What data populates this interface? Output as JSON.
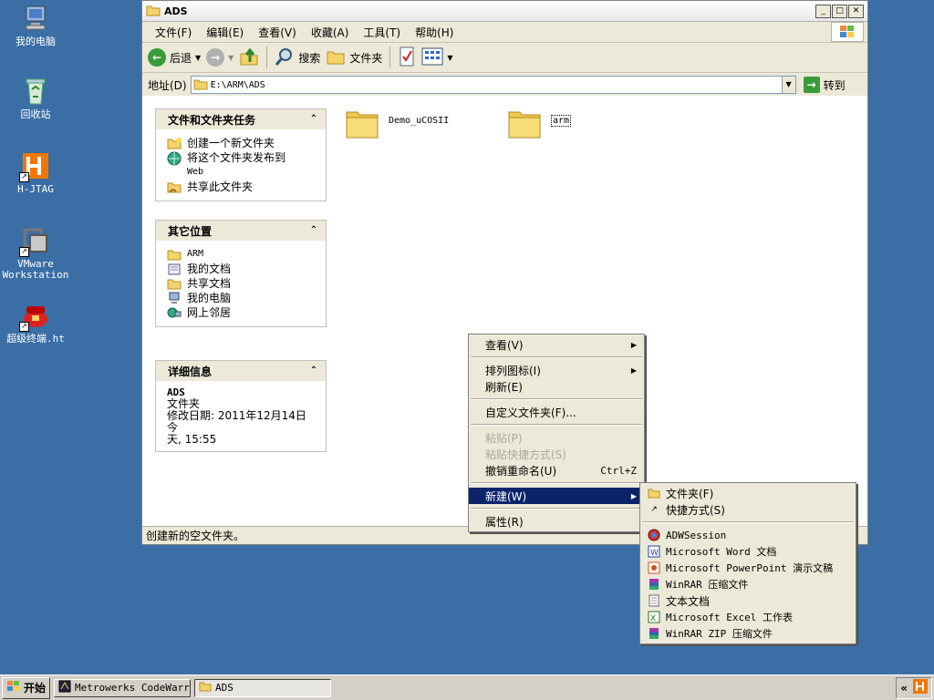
{
  "desktop": {
    "icons": [
      {
        "label": "我的电脑",
        "icon": "my-computer-icon"
      },
      {
        "label": "回收站",
        "icon": "recycle-bin-icon"
      },
      {
        "label": "H-JTAG",
        "icon": "hjtag-icon"
      },
      {
        "label": "VMware Workstation",
        "icon": "vmware-icon"
      },
      {
        "label": "超级终端.ht",
        "icon": "hyperterminal-icon"
      }
    ]
  },
  "window": {
    "title": "ADS",
    "menu": [
      "文件(F)",
      "编辑(E)",
      "查看(V)",
      "收藏(A)",
      "工具(T)",
      "帮助(H)"
    ],
    "toolbar": {
      "back": "后退",
      "search": "搜索",
      "folders": "文件夹"
    },
    "address": {
      "label": "地址(D)",
      "value": "E:\\ARM\\ADS",
      "go": "转到"
    },
    "status": "创建新的空文件夹。"
  },
  "panels": {
    "tasks": {
      "title": "文件和文件夹任务",
      "items": [
        "创建一个新文件夹",
        "将这个文件夹发布到",
        "Web",
        "共享此文件夹"
      ]
    },
    "places": {
      "title": "其它位置",
      "items": [
        "ARM",
        "我的文档",
        "共享文档",
        "我的电脑",
        "网上邻居"
      ]
    },
    "details": {
      "title": "详细信息",
      "name": "ADS",
      "type": "文件夹",
      "modified_line1": "修改日期: 2011年12月14日今",
      "modified_line2": "天, 15:55"
    }
  },
  "folders": [
    {
      "name": "Demo_uCOSII"
    },
    {
      "name": "arm"
    }
  ],
  "context_menu": {
    "items": [
      {
        "label": "查看(V)",
        "submenu": true,
        "disabled": false
      },
      {
        "sep": true
      },
      {
        "label": "排列图标(I)",
        "submenu": true,
        "disabled": false
      },
      {
        "label": "刷新(E)",
        "submenu": false,
        "disabled": false
      },
      {
        "sep": true
      },
      {
        "label": "自定义文件夹(F)...",
        "submenu": false,
        "disabled": false
      },
      {
        "sep": true
      },
      {
        "label": "粘贴(P)",
        "submenu": false,
        "disabled": true
      },
      {
        "label": "粘贴快捷方式(S)",
        "submenu": false,
        "disabled": true
      },
      {
        "label": "撤销重命名(U)",
        "accel": "Ctrl+Z",
        "submenu": false,
        "disabled": false
      },
      {
        "sep": true
      },
      {
        "label": "新建(W)",
        "submenu": true,
        "disabled": false,
        "selected": true
      },
      {
        "sep": true
      },
      {
        "label": "属性(R)",
        "submenu": false,
        "disabled": false
      }
    ]
  },
  "new_submenu": {
    "items": [
      {
        "label": "文件夹(F)",
        "icon": "folder-icon"
      },
      {
        "label": "快捷方式(S)",
        "icon": "shortcut-icon"
      },
      {
        "sep": true
      },
      {
        "label": "ADWSession",
        "icon": "adw-icon"
      },
      {
        "label": "Microsoft Word 文档",
        "icon": "word-icon"
      },
      {
        "label": "Microsoft PowerPoint 演示文稿",
        "icon": "powerpoint-icon"
      },
      {
        "label": "WinRAR 压缩文件",
        "icon": "winrar-icon"
      },
      {
        "label": "文本文档",
        "icon": "text-file-icon"
      },
      {
        "label": "Microsoft Excel 工作表",
        "icon": "excel-icon"
      },
      {
        "label": "WinRAR ZIP 压缩文件",
        "icon": "winrar-zip-icon"
      }
    ]
  },
  "taskbar": {
    "start": "开始",
    "buttons": [
      {
        "label": "Metrowerks CodeWarr...",
        "active": false
      },
      {
        "label": "ADS",
        "active": true
      }
    ],
    "tray_chevron": "«"
  }
}
